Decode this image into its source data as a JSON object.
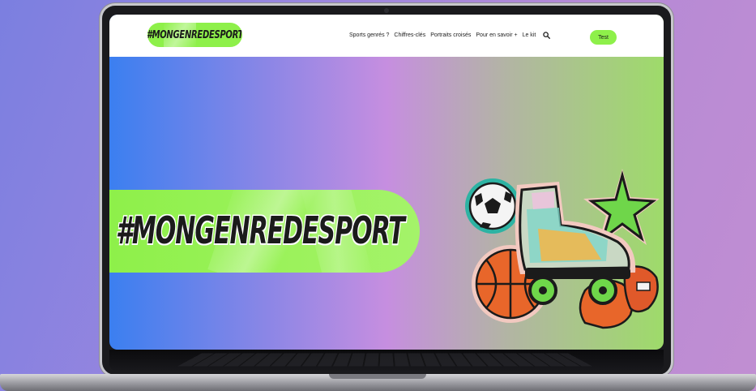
{
  "site": {
    "logo_text": "#MONGENREDESPORT",
    "nav": [
      "Sports genrés ?",
      "Chiffres-clés",
      "Portraits croisés",
      "Pour en savoir +",
      "Le kit"
    ],
    "cta_label": "Test"
  },
  "hero": {
    "title": "#MONGENREDESPORT"
  },
  "colors": {
    "accent_green": "#8ef04a",
    "gradient_blue": "#3b7ff0",
    "gradient_pink": "#c68ee0",
    "gradient_green": "#9edb6a",
    "orange": "#e8662a"
  },
  "icons": [
    "search-icon",
    "soccer-ball-icon",
    "basketball-icon",
    "roller-skate-icon",
    "star-icon",
    "boxing-glove-icon"
  ]
}
